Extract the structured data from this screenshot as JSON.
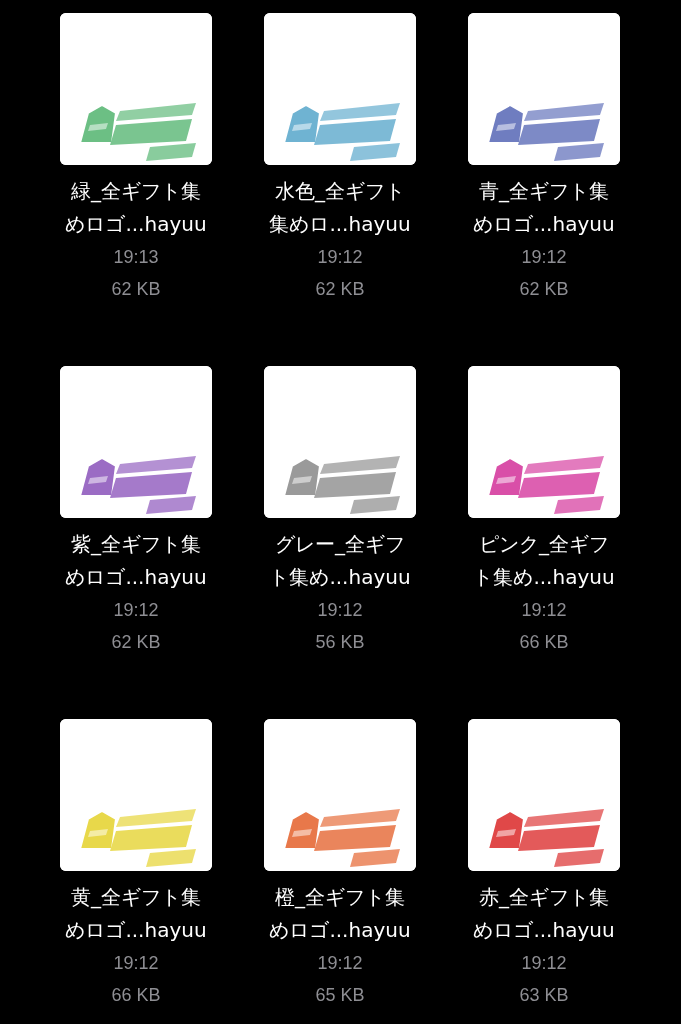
{
  "files": [
    {
      "name_lines": [
        "緑_全ギフト集",
        "めロゴ...hayuu"
      ],
      "time": "19:13",
      "size": "62 KB",
      "color": "#6cbf84"
    },
    {
      "name_lines": [
        "水色_全ギフト",
        "集めロ...hayuu"
      ],
      "time": "19:12",
      "size": "62 KB",
      "color": "#6fb3d2"
    },
    {
      "name_lines": [
        "青_全ギフト集",
        "めロゴ...hayuu"
      ],
      "time": "19:12",
      "size": "62 KB",
      "color": "#6f7dc0"
    },
    {
      "name_lines": [
        "紫_全ギフト集",
        "めロゴ...hayuu"
      ],
      "time": "19:12",
      "size": "62 KB",
      "color": "#9b6cc4"
    },
    {
      "name_lines": [
        "グレー_全ギフ",
        "ト集め...hayuu"
      ],
      "time": "19:12",
      "size": "56 KB",
      "color": "#9a9a9a"
    },
    {
      "name_lines": [
        "ピンク_全ギフ",
        "ト集め...hayuu"
      ],
      "time": "19:12",
      "size": "66 KB",
      "color": "#d94fa8"
    },
    {
      "name_lines": [
        "黄_全ギフト集",
        "めロゴ...hayuu"
      ],
      "time": "19:12",
      "size": "66 KB",
      "color": "#e8d84a"
    },
    {
      "name_lines": [
        "橙_全ギフト集",
        "めロゴ...hayuu"
      ],
      "time": "19:12",
      "size": "65 KB",
      "color": "#e8784a"
    },
    {
      "name_lines": [
        "赤_全ギフト集",
        "めロゴ...hayuu"
      ],
      "time": "19:12",
      "size": "63 KB",
      "color": "#e04848"
    }
  ]
}
